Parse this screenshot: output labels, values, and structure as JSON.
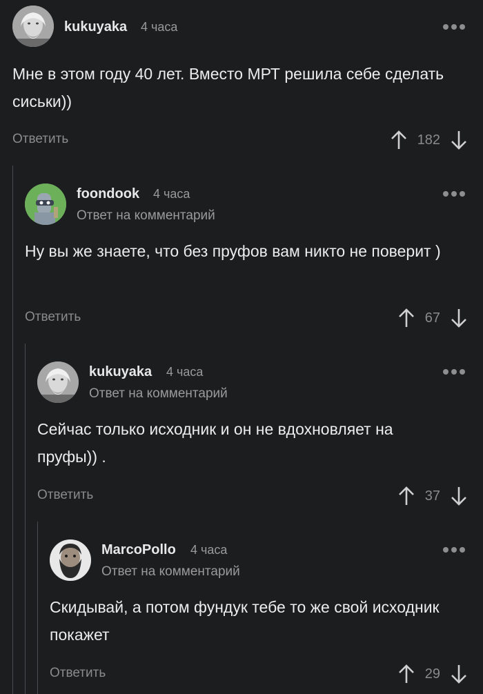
{
  "comments": [
    {
      "author": "kukuyaka",
      "time": "4 часа",
      "reply_to": "",
      "text": "Мне в этом году 40 лет. Вместо МРТ решила себе сделать сиськи))",
      "reply_label": "Ответить",
      "score": "182",
      "avatar_icon": "old-man-avatar"
    },
    {
      "author": "foondook",
      "time": "4 часа",
      "reply_to": "Ответ на комментарий",
      "text": "Ну вы же знаете, что без пруфов вам никто не поверит )",
      "reply_label": "Ответить",
      "score": "67",
      "avatar_icon": "robot-avatar"
    },
    {
      "author": "kukuyaka",
      "time": "4 часа",
      "reply_to": "Ответ на комментарий",
      "text": "Сейчас только исходник и он не вдохновляет на пруфы)) .",
      "reply_label": "Ответить",
      "score": "37",
      "avatar_icon": "old-man-avatar"
    },
    {
      "author": "MarcoPollo",
      "time": "4 часа",
      "reply_to": "Ответ на комментарий",
      "text": "Скидывай, а потом фундук тебе то же свой исходник покажет",
      "reply_label": "Ответить",
      "score": "29",
      "avatar_icon": "bearded-man-avatar"
    }
  ],
  "colors": {
    "background": "#1c1d1f",
    "text": "#ececec",
    "muted": "#8b8b8b",
    "thread_line": "#4a4b4e"
  }
}
